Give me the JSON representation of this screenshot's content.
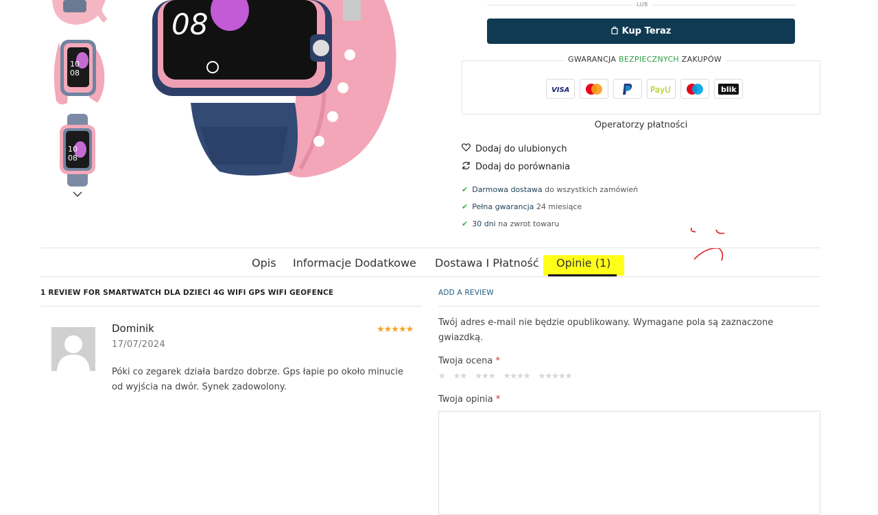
{
  "thumbnails": [
    {
      "alt": "thumb-1"
    },
    {
      "alt": "thumb-2",
      "watch_time": "10\n08"
    },
    {
      "alt": "thumb-3",
      "watch_time": "10\n08"
    }
  ],
  "main_watch_time": "08",
  "lub_label": "LUB",
  "buy_button": "Kup Teraz",
  "guarantee": {
    "part1": "GWARANCJA ",
    "part2": "BEZPIECZNYCH",
    "part3": " ZAKUPÓW"
  },
  "payment_methods": [
    "VISA",
    "Mastercard",
    "PayPal",
    "PayU",
    "Maestro",
    "blik"
  ],
  "operators_text": "Operatorzy płatności",
  "wishlist": "Dodaj do ulubionych",
  "compare": "Dodaj do porównania",
  "perks": [
    {
      "bold": "Darmowa dostawa",
      "rest": " do wszystkich zamówień"
    },
    {
      "bold": "Pełna gwarancja",
      "rest": " 24 miesiące"
    },
    {
      "bold": "30 dni",
      "rest": " na zwrot towaru"
    }
  ],
  "tabs": [
    "Opis",
    "Informacje Dodatkowe",
    "Dostawa I Płatność",
    "Opinie (1)"
  ],
  "active_tab": "Opinie (1)",
  "reviews_heading": "1 REVIEW FOR SMARTWATCH DLA DZIECI 4G WIFI GPS WIFI GEOFENCE",
  "review": {
    "author": "Dominik",
    "date": "17/07/2024",
    "rating": 5,
    "stars": "★★★★★",
    "text": "Póki co zegarek działa bardzo dobrze. Gps łapie po około minucie od wyjścia na dwór. Synek zadowolony."
  },
  "add_review": {
    "heading": "ADD A REVIEW",
    "note": "Twój adres e-mail nie będzie opublikowany. Wymagane pola są zaznaczone gwiazdką.",
    "rating_label": "Twoja ocena",
    "rating_options": [
      "★",
      "★★",
      "★★★",
      "★★★★",
      "★★★★★"
    ],
    "review_label": "Twoja opinia",
    "required_mark": "*"
  },
  "colors": {
    "buy": "#0f3a52",
    "highlight": "#ffff1a",
    "check": "#35b04a",
    "star": "#f5a623",
    "annotation": "#e02020"
  }
}
